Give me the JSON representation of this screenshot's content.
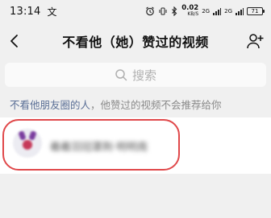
{
  "status_bar": {
    "time": "13:14",
    "notif_glyph": "文",
    "net_speed": "0.02",
    "net_unit": "KB/S",
    "sig1": "2G",
    "sig2": "2G",
    "battery": "71"
  },
  "nav": {
    "title": "不看他（她）赞过的视频"
  },
  "search": {
    "placeholder": "搜索"
  },
  "hint": {
    "accent": "不看他朋友圈的人",
    "rest": "，他赞过的视频不会推荐给你"
  },
  "user_list": [
    {
      "name": "羲羲羽冠罩荆·明明南"
    }
  ],
  "colors": {
    "highlight": "#e0484a",
    "hint_accent": "#5b6f96"
  }
}
